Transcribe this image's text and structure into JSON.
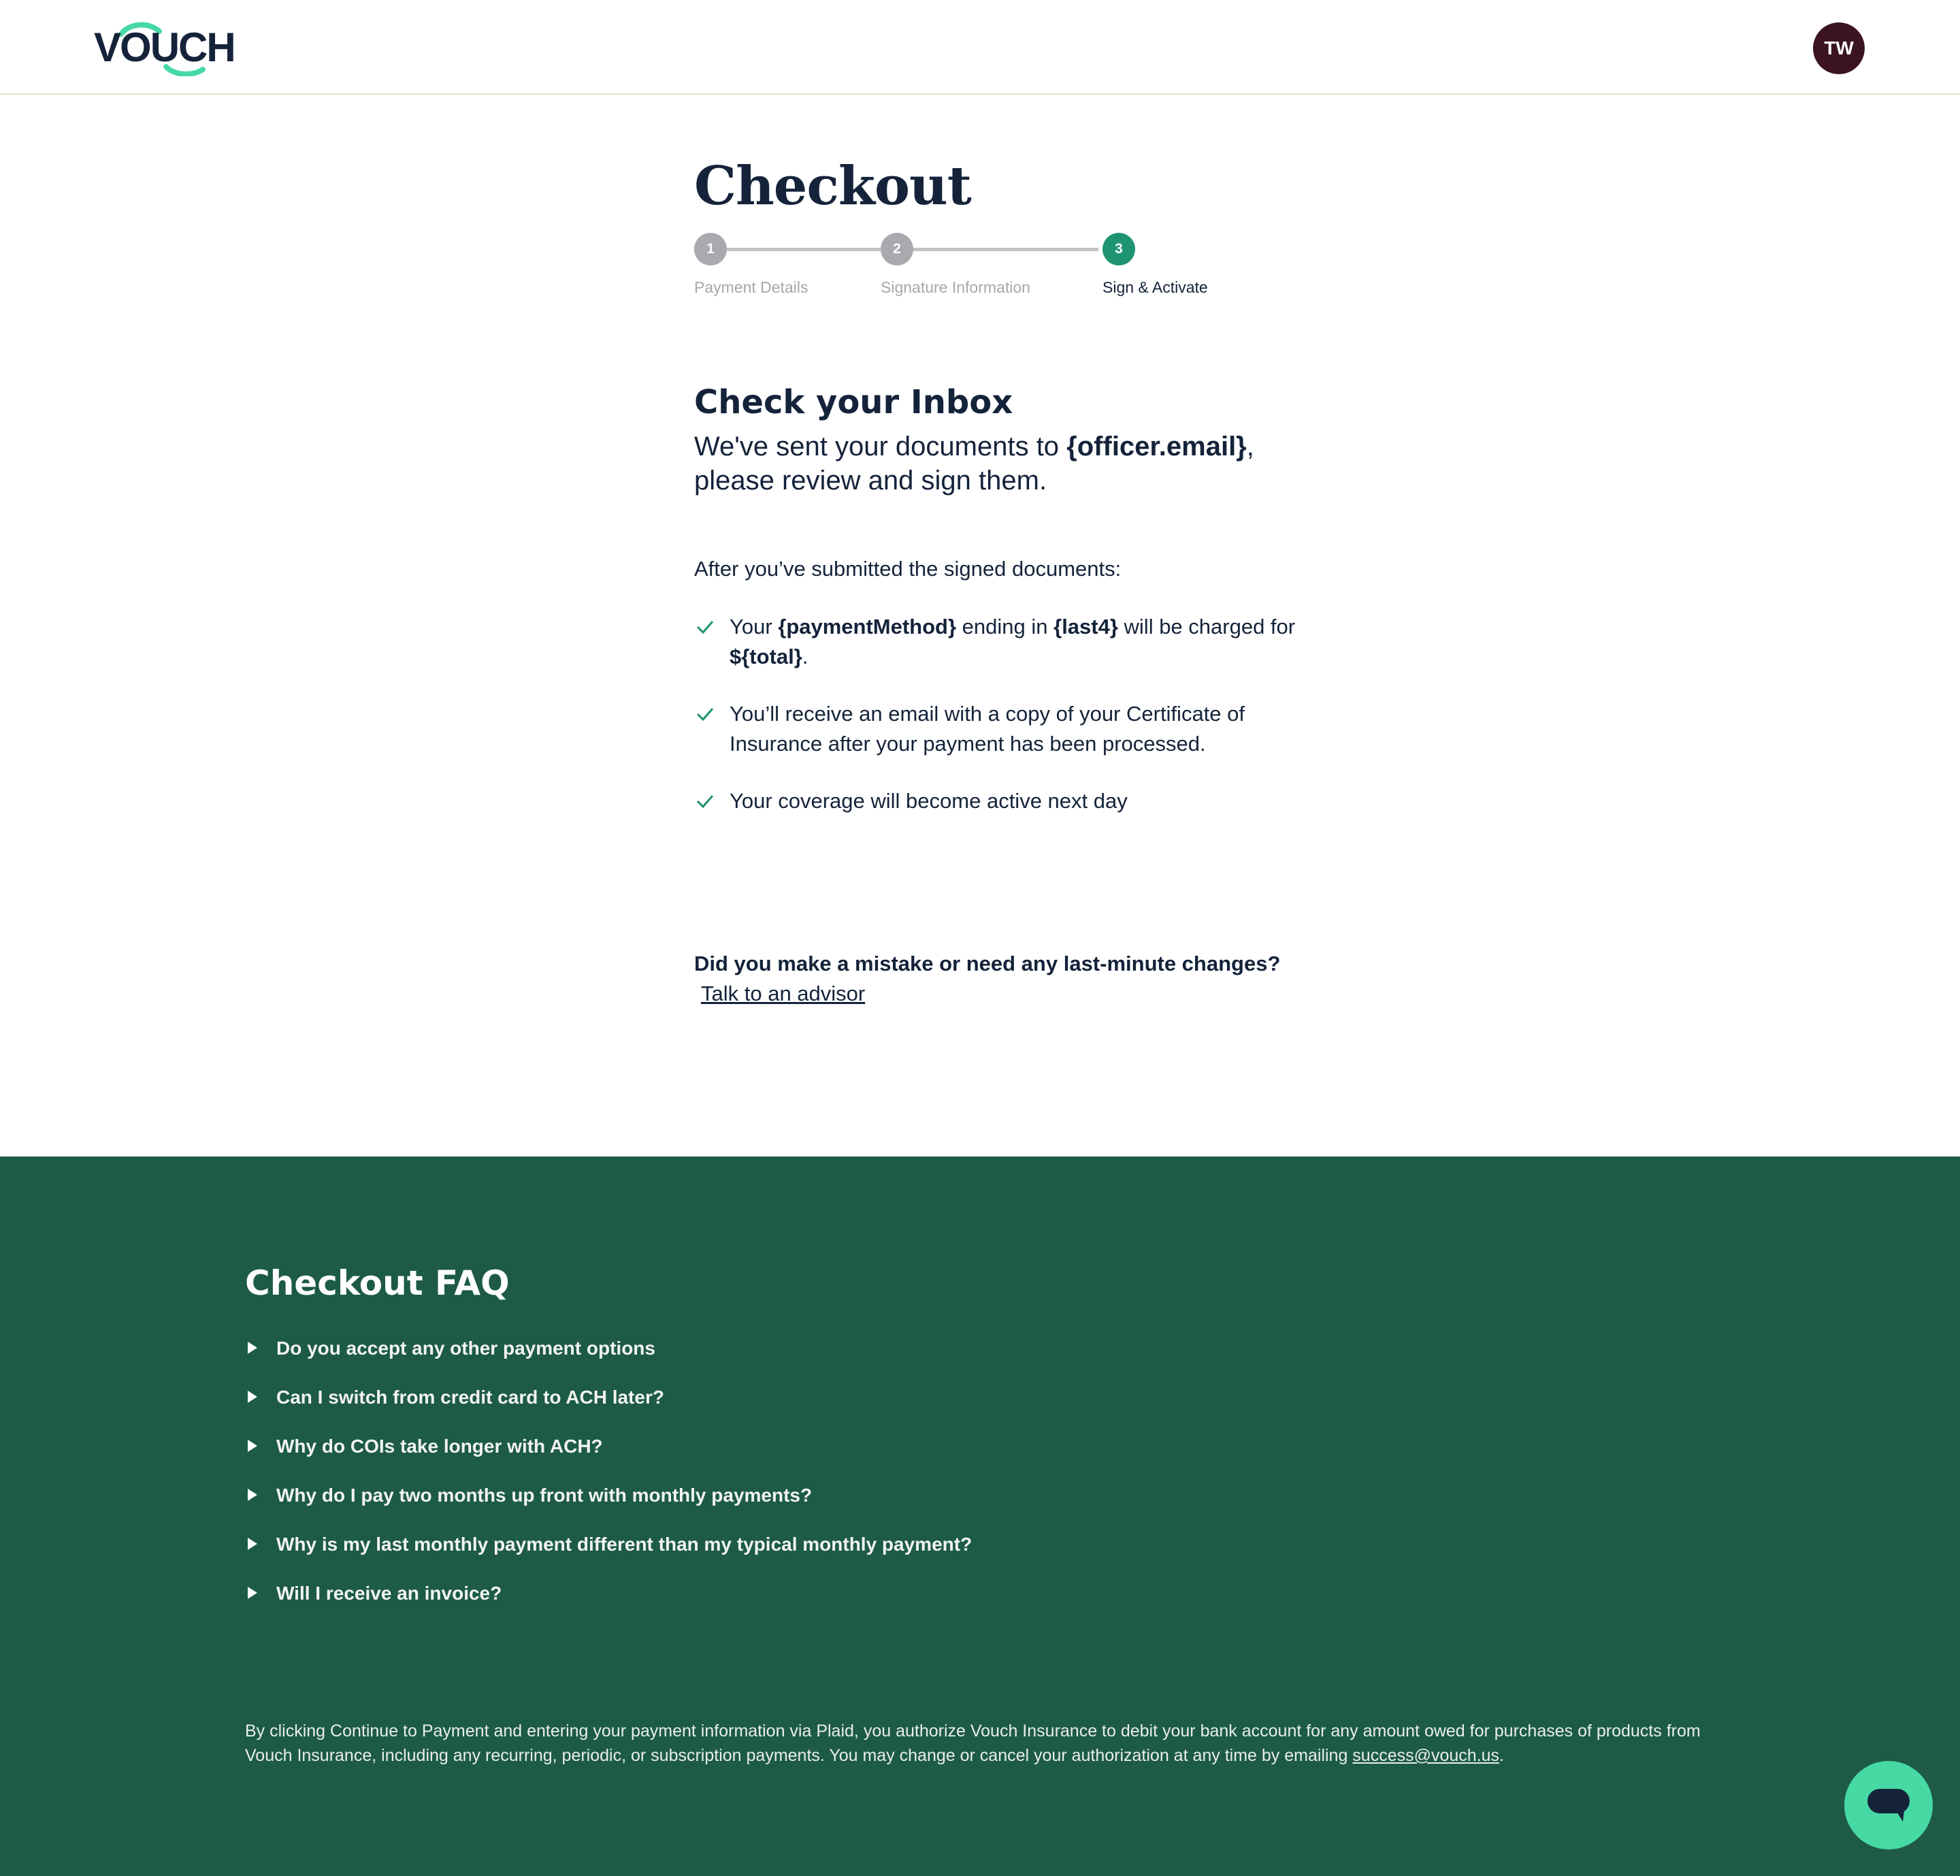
{
  "header": {
    "logo_text": "VOUCH",
    "avatar_initials": "TW"
  },
  "page": {
    "title": "Checkout"
  },
  "stepper": {
    "steps": [
      {
        "number": "1",
        "label": "Payment Details",
        "state": "complete"
      },
      {
        "number": "2",
        "label": "Signature Information",
        "state": "complete"
      },
      {
        "number": "3",
        "label": "Sign & Activate",
        "state": "active"
      }
    ]
  },
  "inbox": {
    "title": "Check your Inbox",
    "text_before": "We've sent your documents to ",
    "email_var": "{officer.email}",
    "text_after": ", please review and sign them."
  },
  "after": {
    "intro": "After you’ve submitted the signed documents:",
    "items": [
      {
        "p1": "Your ",
        "b1": "{paymentMethod}",
        "p2": " ending in ",
        "b2": "{last4}",
        "p3": " will be charged for ",
        "b3": "${total}",
        "p4": "."
      },
      {
        "text": "You’ll receive an email with a copy of your Certificate of Insurance after your payment has been processed."
      },
      {
        "text": "Your coverage will become active next day"
      }
    ]
  },
  "help": {
    "question": "Did you make a mistake or need any last-minute changes?",
    "link": "Talk to an advisor"
  },
  "faq": {
    "title": "Checkout FAQ",
    "items": [
      "Do you accept any other payment options",
      "Can I switch from credit card to ACH later?",
      "Why do COIs take longer with ACH?",
      "Why do I pay two months up front with monthly payments?",
      "Why is my last monthly payment different than my typical monthly payment?",
      "Will I receive an invoice?"
    ]
  },
  "legal": {
    "text": "By clicking Continue to Payment and entering your payment information via Plaid, you authorize Vouch Insurance to debit your bank account for any amount owed for purchases of products from Vouch Insurance, including any recurring, periodic, or subscription payments. You may change or cancel your authorization at any time by emailing ",
    "email": "success@vouch.us",
    "end": "."
  },
  "colors": {
    "brand_navy": "#14233a",
    "brand_green": "#1f9470",
    "footer_green": "#1d5a48",
    "chat_mint": "#46d9a4",
    "avatar_bg": "#3b1420",
    "step_inactive": "#a9a9ae"
  },
  "icons": {
    "check": "check-icon",
    "faq_toggle": "triangle-right-icon",
    "chat": "chat-bubble-icon"
  }
}
